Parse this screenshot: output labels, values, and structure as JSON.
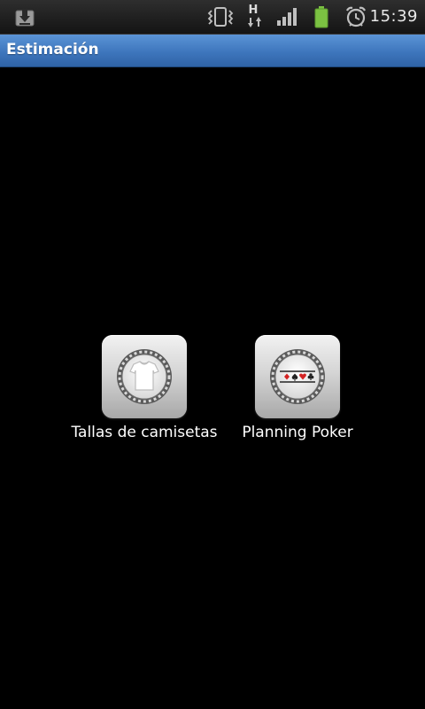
{
  "status_bar": {
    "time": "15:39",
    "icons": [
      "download-icon",
      "vibrate-icon",
      "hspa-data-icon",
      "signal-icon",
      "battery-icon",
      "alarm-clock-icon"
    ],
    "network_label": "H",
    "colors": {
      "battery": "#7bc242",
      "icons": "#bfbfbf"
    }
  },
  "app_bar": {
    "title": "Estimación",
    "color": "#3e76bd"
  },
  "launcher": {
    "items": [
      {
        "label": "Tallas de camisetas",
        "icon": "t-shirt-icon"
      },
      {
        "label": "Planning Poker",
        "icon": "poker-chip-icon"
      }
    ]
  }
}
